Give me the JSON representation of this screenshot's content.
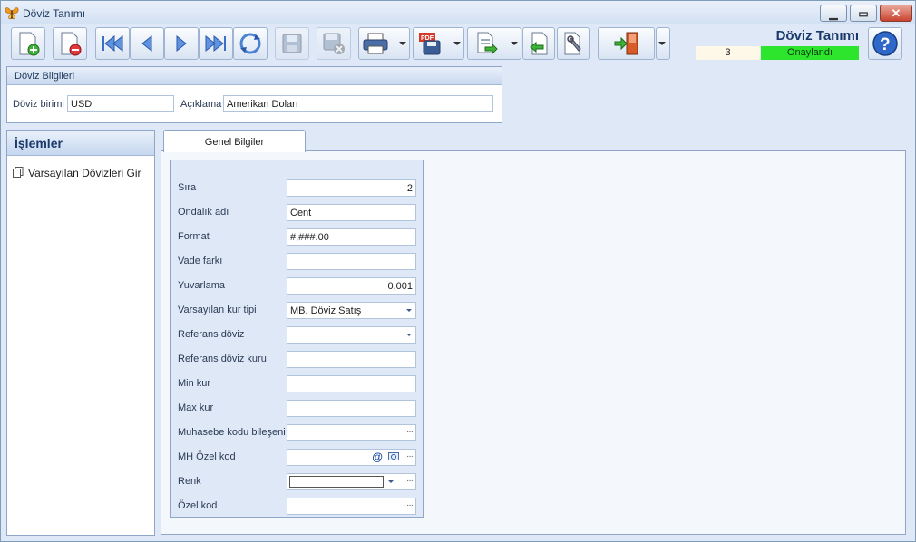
{
  "window": {
    "title": "Döviz Tanımı"
  },
  "toolbar": {
    "buttons": [
      {
        "name": "new-record-icon"
      },
      {
        "name": "delete-record-icon"
      },
      {
        "name": "first-record-icon"
      },
      {
        "name": "prev-record-icon"
      },
      {
        "name": "next-record-icon"
      },
      {
        "name": "last-record-icon"
      },
      {
        "name": "refresh-icon"
      },
      {
        "name": "save-icon"
      },
      {
        "name": "save-cancel-icon"
      },
      {
        "name": "print-icon"
      },
      {
        "name": "pdf-export-icon"
      },
      {
        "name": "export-icon"
      },
      {
        "name": "import-icon"
      },
      {
        "name": "tools-icon"
      },
      {
        "name": "exit-icon"
      }
    ]
  },
  "header": {
    "title": "Döviz Tanımı",
    "record_no": "3",
    "status": "Onaylandı",
    "status_color": "#2ee52e"
  },
  "currency_info": {
    "group_title": "Döviz Bilgileri",
    "code_label": "Döviz birimi",
    "code_value": "USD",
    "desc_label": "Açıklama",
    "desc_value": "Amerikan Doları"
  },
  "left_panel": {
    "title": "İşlemler",
    "items": [
      {
        "label": "Varsayılan Dövizleri Gir"
      }
    ]
  },
  "tabs": [
    {
      "label": "Genel Bilgiler"
    }
  ],
  "form": {
    "sira": {
      "label": "Sıra",
      "value": "2"
    },
    "ondalik": {
      "label": "Ondalık adı",
      "value": "Cent"
    },
    "format": {
      "label": "Format",
      "value": "#,###.00"
    },
    "vade": {
      "label": "Vade farkı",
      "value": ""
    },
    "yuvarlama": {
      "label": "Yuvarlama",
      "value": "0,001"
    },
    "kur_tipi": {
      "label": "Varsayılan kur tipi",
      "value": "MB. Döviz Satış"
    },
    "ref_doviz": {
      "label": "Referans döviz",
      "value": ""
    },
    "ref_kur": {
      "label": "Referans döviz kuru",
      "value": ""
    },
    "min_kur": {
      "label": "Min kur",
      "value": ""
    },
    "max_kur": {
      "label": "Max kur",
      "value": ""
    },
    "muhasebe": {
      "label": "Muhasebe kodu bileşeni",
      "value": ""
    },
    "mh_ozel": {
      "label": "MH Özel kod",
      "value": ""
    },
    "renk": {
      "label": "Renk",
      "value": ""
    },
    "ozel_kod": {
      "label": "Özel kod",
      "value": ""
    }
  }
}
